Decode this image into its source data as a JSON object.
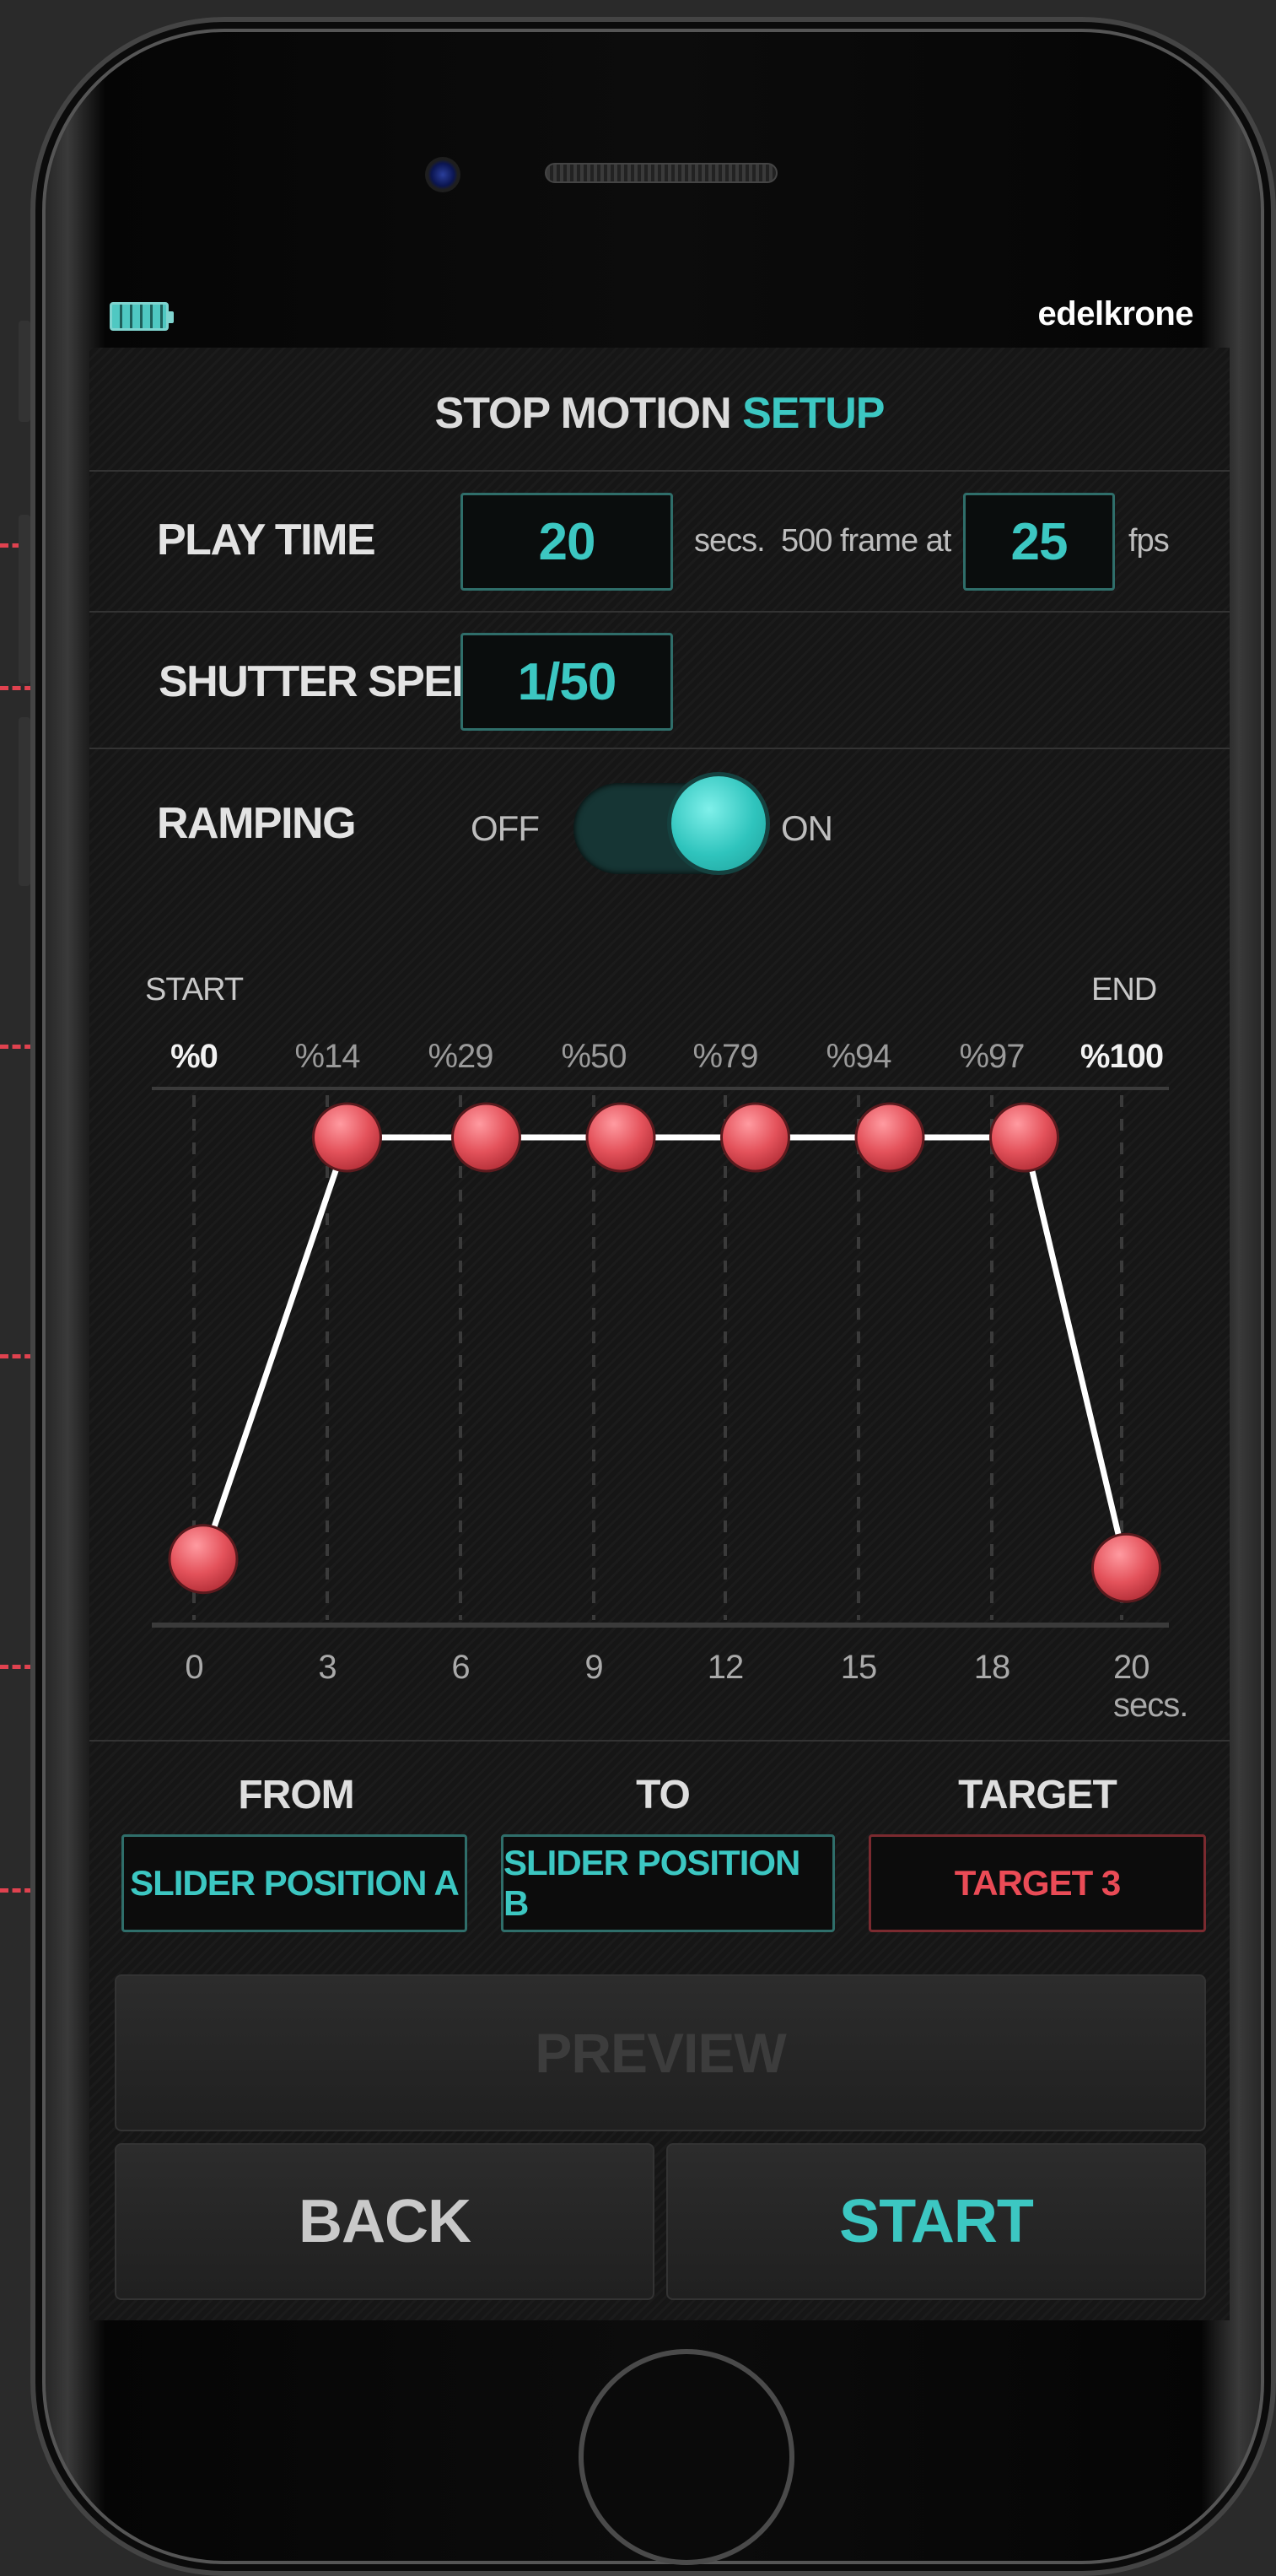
{
  "header": {
    "brand": "edelkrone"
  },
  "title": {
    "prefix": "STOP MOTION",
    "accent": "SETUP"
  },
  "play_time": {
    "label": "PLAY TIME",
    "value": "20",
    "unit": "secs.",
    "frame_text": "500 frame at",
    "fps_value": "25",
    "fps_unit": "fps"
  },
  "shutter": {
    "label": "SHUTTER SPEED",
    "value": "1/50"
  },
  "ramping": {
    "label": "RAMPING",
    "off_label": "OFF",
    "on_label": "ON",
    "enabled": true
  },
  "chart_data": {
    "type": "line",
    "start_label": "START",
    "end_label": "END",
    "percent_labels": [
      "%0",
      "%14",
      "%29",
      "%50",
      "%79",
      "%94",
      "%97",
      "%100"
    ],
    "x_tick_labels": [
      "0",
      "3",
      "6",
      "9",
      "12",
      "15",
      "18",
      "20 secs."
    ],
    "x": [
      0.2,
      3.3,
      6.3,
      9.2,
      12.1,
      15.0,
      17.9,
      20.1
    ],
    "y": [
      0.05,
      1,
      1,
      1,
      1,
      1,
      1,
      0.03
    ],
    "xlim": [
      0,
      20
    ],
    "ylim": [
      0,
      1
    ],
    "grid": true,
    "point_color": "#e4525b",
    "line_color": "#ffffff"
  },
  "motion": {
    "from_label": "FROM",
    "to_label": "TO",
    "target_label": "TARGET",
    "from_value": "SLIDER POSITION A",
    "to_value": "SLIDER POSITION B",
    "target_value": "TARGET 3"
  },
  "buttons": {
    "preview": "PREVIEW",
    "back": "BACK",
    "start": "START"
  },
  "colors": {
    "accent": "#3cc7c2",
    "danger": "#ea4b56",
    "guide": "#e0424f"
  }
}
